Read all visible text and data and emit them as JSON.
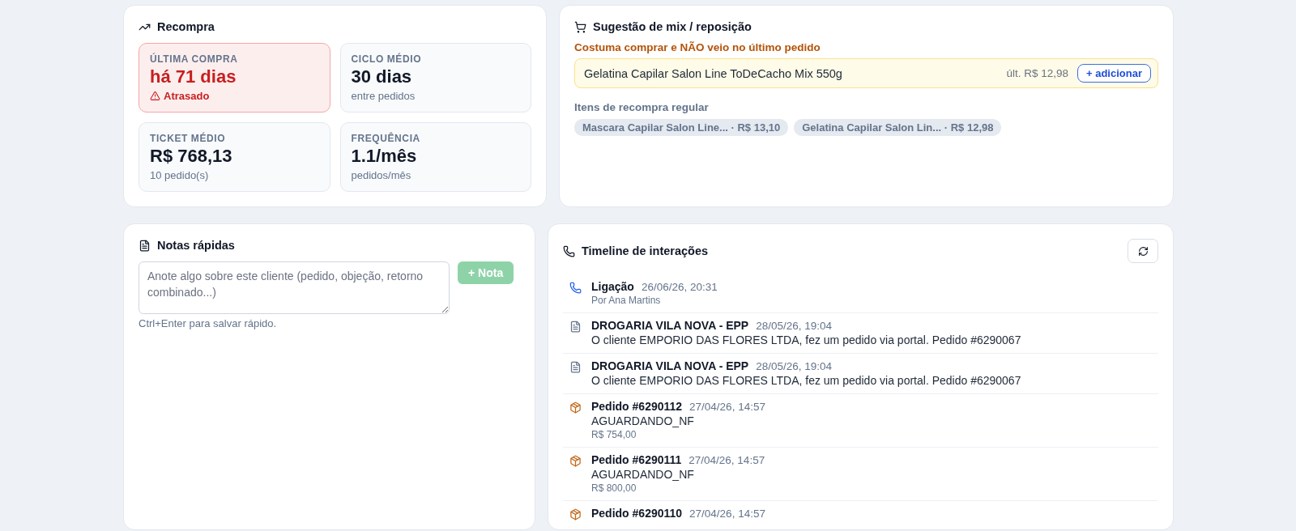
{
  "recompra": {
    "title": "Recompra",
    "metrics": [
      {
        "label": "ÚLTIMA COMPRA",
        "value": "há 71 dias",
        "note": "Atrasado",
        "alert": true
      },
      {
        "label": "CICLO MÉDIO",
        "value": "30 dias",
        "note": "entre pedidos",
        "alert": false
      },
      {
        "label": "TICKET MÉDIO",
        "value": "R$ 768,13",
        "note": "10 pedido(s)",
        "alert": false
      },
      {
        "label": "FREQUÊNCIA",
        "value": "1.1/mês",
        "note": "pedidos/mês",
        "alert": false
      }
    ]
  },
  "mix": {
    "title": "Sugestão de mix / reposição",
    "missing_heading": "Costuma comprar e NÃO veio no último pedido",
    "missing_items": [
      {
        "name": "Gelatina Capilar Salon Line ToDeCacho Mix 550g",
        "last_price": "últ. R$ 12,98",
        "action": "+ adicionar"
      }
    ],
    "regular_heading": "Itens de recompra regular",
    "regular_items": [
      "Mascara Capilar Salon Line... · R$ 13,10",
      "Gelatina Capilar Salon Lin... · R$ 12,98"
    ]
  },
  "notes": {
    "title": "Notas rápidas",
    "placeholder": "Anote algo sobre este cliente (pedido, objeção, retorno combinado...)",
    "button": "+ Nota",
    "button_disabled": true,
    "hint": "Ctrl+Enter para salvar rápido."
  },
  "timeline": {
    "title": "Timeline de interações",
    "items": [
      {
        "kind": "call",
        "title": "Ligação",
        "time": "26/06/26, 20:31",
        "meta": "Por Ana Martins"
      },
      {
        "kind": "note",
        "title": "DROGARIA VILA NOVA - EPP",
        "time": "28/05/26, 19:04",
        "body": "O cliente EMPORIO DAS FLORES LTDA, fez um pedido via portal. Pedido #6290067"
      },
      {
        "kind": "note",
        "title": "DROGARIA VILA NOVA - EPP",
        "time": "28/05/26, 19:04",
        "body": "O cliente EMPORIO DAS FLORES LTDA, fez um pedido via portal. Pedido #6290067"
      },
      {
        "kind": "order",
        "title": "Pedido #6290112",
        "time": "27/04/26, 14:57",
        "body": "AGUARDANDO_NF",
        "meta": "R$ 754,00"
      },
      {
        "kind": "order",
        "title": "Pedido #6290111",
        "time": "27/04/26, 14:57",
        "body": "AGUARDANDO_NF",
        "meta": "R$ 800,00"
      },
      {
        "kind": "order",
        "title": "Pedido #6290110",
        "time": "27/04/26, 14:57"
      }
    ]
  }
}
